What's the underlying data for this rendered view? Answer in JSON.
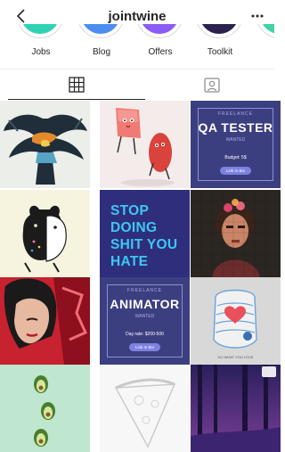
{
  "header": {
    "title": "jointwine",
    "back_icon": "chevron-left-icon",
    "more_icon": "more-horizontal-icon"
  },
  "highlights": [
    {
      "label": "Jobs",
      "color": "#2fd3b4"
    },
    {
      "label": "Blog",
      "color": "#4a8ef0"
    },
    {
      "label": "Offers",
      "color": "#8b5cf6"
    },
    {
      "label": "Toolkit",
      "color": "#2b2250"
    },
    {
      "label": "",
      "color": "#3fd3a7"
    }
  ],
  "tabs": [
    {
      "name": "grid",
      "icon": "grid-icon",
      "active": true
    },
    {
      "name": "tagged",
      "icon": "tagged-person-icon",
      "active": false
    }
  ],
  "posts": {
    "qa": {
      "tag": "FREELANCE",
      "title": "QA TESTER",
      "sub": "WANTED",
      "info": "Budget: 5$",
      "button": "Link In Bio"
    },
    "stop": {
      "text_lines": [
        "STOP",
        "DOING",
        "SHIT YOU",
        "HATE"
      ]
    },
    "animator": {
      "tag": "FREELANCE",
      "title": "ANIMATOR",
      "sub": "WANTED",
      "info": "Day rate: $200-500",
      "button": "Link In Bio"
    },
    "heart": {
      "caption": "DO WHAT YOU LOVE"
    }
  }
}
